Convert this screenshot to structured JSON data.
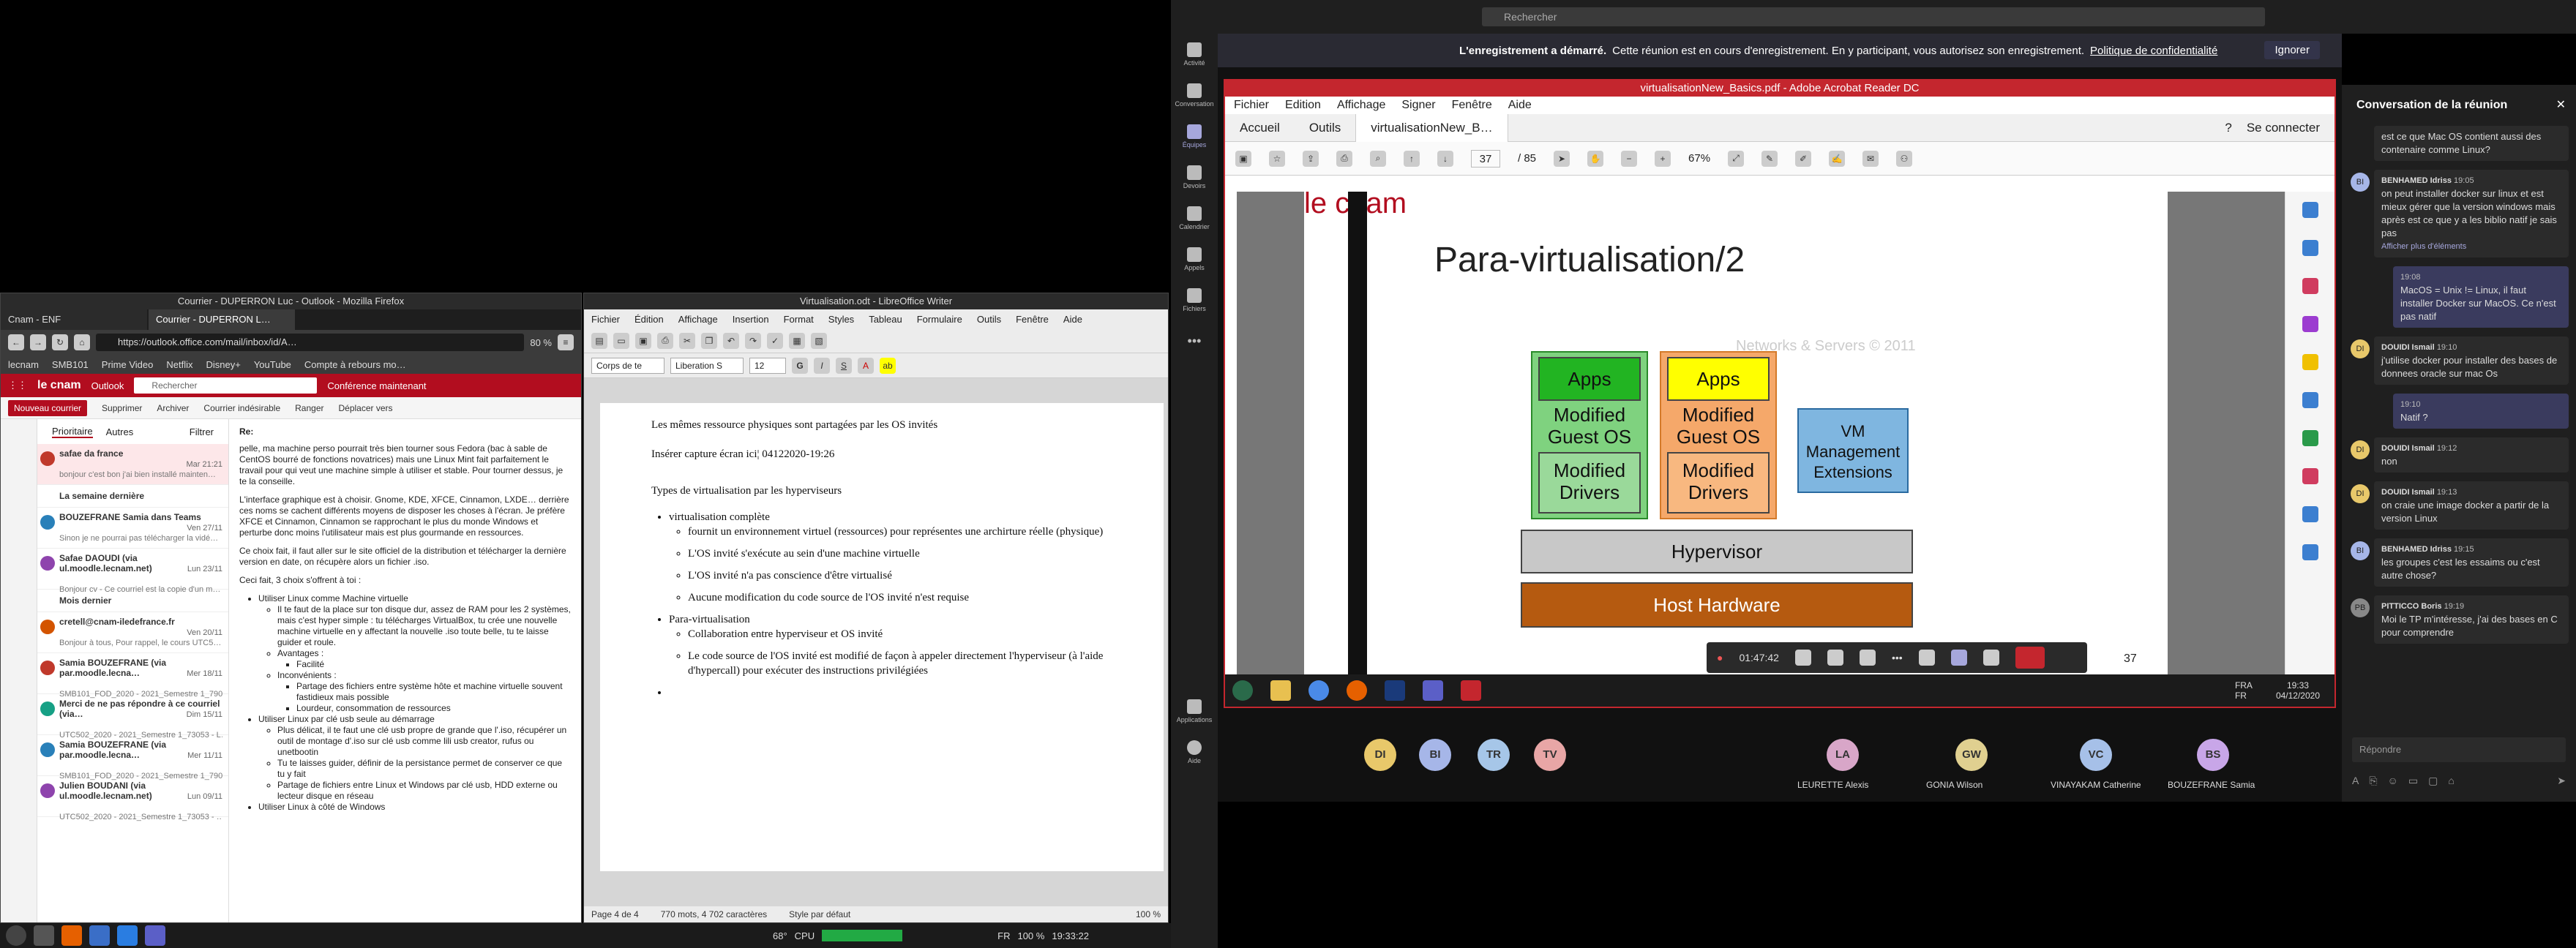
{
  "firefox": {
    "title": "Courrier - DUPERRON Luc - Outlook - Mozilla Firefox",
    "tabs": [
      "Cnam - ENF",
      "Courrier - DUPERRON L…"
    ],
    "url": "https://outlook.office.com/mail/inbox/id/A…",
    "zoom": "80 %",
    "bookmarks": [
      "lecnam",
      "SMB101",
      "Prime Video",
      "Netflix",
      "Disney+",
      "YouTube",
      "Compte à rebours mo…"
    ]
  },
  "outlook": {
    "brand": "Outlook",
    "search_placeholder": "Rechercher",
    "conf_link": "Conférence maintenant",
    "commands": [
      "Nouveau courrier",
      "Supprimer",
      "Archiver",
      "Courrier indésirable",
      "Ranger",
      "Déplacer vers"
    ],
    "list_tabs": [
      "Prioritaire",
      "Autres",
      "Filtrer"
    ],
    "reply_label": "Re:",
    "mails": [
      {
        "from": "safae da france",
        "prev": "bonjour c'est bon j'ai bien installé mainten…",
        "date": "Mar 21:21",
        "sel": true
      },
      {
        "section": "La semaine dernière"
      },
      {
        "from": "BOUZEFRANE Samia dans Teams",
        "prev": "Sinon je ne pourrai pas télécharger la vidé…",
        "date": "Ven 27/11"
      },
      {
        "from": "Safae DAOUDI (via ul.moodle.lecnam.net)",
        "prev": "Bonjour cv - Ce courriel est la copie d'un m…",
        "date": "Lun 23/11"
      },
      {
        "section": "Mois dernier"
      },
      {
        "from": "cretell@cnam-iledefrance.fr",
        "prev": "Bonjour à tous, Pour rappel, le cours UTC5…",
        "date": "Ven 20/11"
      },
      {
        "from": "Samia BOUZEFRANE (via par.moodle.lecna…",
        "prev": "SMB101_FOD_2020 - 2021_Semestre 1_7905…",
        "date": "Mer 18/11"
      },
      {
        "from": "Merci de ne pas répondre à ce courriel (via…",
        "prev": "UTC502_2020 - 2021_Semestre 1_73053 - L…",
        "date": "Dim 15/11"
      },
      {
        "from": "Samia BOUZEFRANE (via par.moodle.lecna…",
        "prev": "SMB101_FOD_2020 - 2021_Semestre 1_790…",
        "date": "Mer 11/11"
      },
      {
        "from": "Julien BOUDANI (via ul.moodle.lecnam.net)",
        "prev": "UTC502_2020 - 2021_Semestre 1_73053 - …",
        "date": "Lun 09/11"
      }
    ],
    "reading": {
      "p1": "pelle, ma machine perso pourrait très bien tourner sous Fedora (bac à sable de CentOS bourré de fonctions novatrices) mais une Linux Mint fait parfaitement le travail pour qui veut une machine simple à utiliser et stable. Pour tourner dessus, je te la conseille.",
      "p2": "L'interface graphique est à choisir. Gnome, KDE, XFCE, Cinnamon, LXDE… derrière ces noms se cachent différents moyens de disposer les choses à l'écran. Je préfère XFCE et Cinnamon, Cinnamon se rapprochant le plus du monde Windows et perturbe donc moins l'utilisateur mais est plus gourmande en ressources.",
      "p3": "Ce choix fait, il faut aller sur le site officiel de la distribution et télécharger la dernière version en date, on récupère alors un fichier .iso.",
      "p4": "Ceci fait, 3 choix s'offrent à toi :",
      "b1": "Utiliser Linux comme Machine virtuelle",
      "b1a": "Il te faut de la place sur ton disque dur, assez de RAM pour les 2 systèmes, mais c'est hyper simple : tu télécharges VirtualBox, tu crée une nouvelle machine virtuelle en y affectant la nouvelle .iso toute belle, tu te laisse guider et roule.",
      "b1b": "Avantages :",
      "b1b1": "Facilité",
      "b1c": "Inconvénients :",
      "b1c1": "Partage des fichiers entre système hôte et machine virtuelle souvent fastidieux mais possible",
      "b1c2": "Lourdeur, consommation de ressources",
      "b2": "Utiliser Linux par clé usb seule au démarrage",
      "b2a": "Plus délicat, il te faut une clé usb propre de grande que l'.iso, récupérer un outil de montage d'.iso sur clé usb comme lili usb creator, rufus ou unetbootin",
      "b2b": "Tu te laisses guider, définir de la persistance permet de conserver ce que tu y fait",
      "b2c": "Partage de fichiers entre Linux et Windows par clé usb, HDD externe ou lecteur disque en réseau",
      "b3": "Utiliser Linux à côté de Windows"
    }
  },
  "writer": {
    "title": "Virtualisation.odt - LibreOffice Writer",
    "menu": [
      "Fichier",
      "Édition",
      "Affichage",
      "Insertion",
      "Format",
      "Styles",
      "Tableau",
      "Formulaire",
      "Outils",
      "Fenêtre",
      "Aide"
    ],
    "style": "Corps de te",
    "font": "Liberation S",
    "size": "12",
    "doc": {
      "l1": "Les mêmes ressource physiques sont partagées par les OS invités",
      "l2": "Insérer capture écran ici¦ 04122020-19:26",
      "l3": "Types de virtualisation par les hyperviseurs",
      "b1": "virtualisation complète",
      "b1a": "fournit un environnement virtuel (ressources) pour représentes une archirture réelle (physique)",
      "b1b": "L'OS invité s'exécute au sein d'une machine virtuelle",
      "b1c": "L'OS invité n'a pas conscience d'être virtualisé",
      "b1d": "Aucune modification du code source de l'OS invité n'est requise",
      "b2": "Para-virtualisation",
      "b2a": "Collaboration entre hyperviseur et OS invité",
      "b2b": "Le code source de l'OS invité est modifié de façon à appeler directement l'hyperviseur (à l'aide d'hypercall) pour exécuter des instructions privilégiées"
    },
    "status": [
      "Page 4 de 4",
      "770 mots, 4 702 caractères",
      "Style par défaut",
      "100 %"
    ]
  },
  "taskbar": {
    "temp": "68°",
    "cpu": "CPU",
    "lang": "FR",
    "battery": "100 %",
    "time": "19:33:22"
  },
  "teams": {
    "search": "Rechercher",
    "rail": [
      "Activité",
      "Conversation",
      "Équipes",
      "Devoirs",
      "Calendrier",
      "Appels",
      "Fichiers",
      "Applications",
      "Aide"
    ],
    "banner_bold": "L'enregistrement a démarré.",
    "banner_text": "Cette réunion est en cours d'enregistrement. En y participant, vous autorisez son enregistrement.",
    "banner_link": "Politique de confidentialité",
    "banner_ignore": "Ignorer",
    "timer": "01:47:42",
    "participants": [
      {
        "init": "DI",
        "color": "#e8c86a"
      },
      {
        "init": "BI",
        "color": "#a6b6e8"
      },
      {
        "init": "TR",
        "color": "#a6c6e8"
      },
      {
        "init": "TV",
        "color": "#e8a6a6"
      },
      {
        "init": "LA",
        "color": "#d8a6c8",
        "name": "LEURETTE Alexis"
      },
      {
        "init": "GW",
        "color": "#e0d090",
        "name": "GONIA Wilson"
      },
      {
        "init": "VC",
        "color": "#a6c0e8",
        "name": "VINAYAKAM Catherine"
      },
      {
        "init": "BS",
        "color": "#c8a6e8",
        "name": "BOUZEFRANE Samia"
      }
    ]
  },
  "acrobat": {
    "title": "virtualisationNew_Basics.pdf - Adobe Acrobat Reader DC",
    "menu": [
      "Fichier",
      "Edition",
      "Affichage",
      "Signer",
      "Fenêtre",
      "Aide"
    ],
    "tabs": [
      "Accueil",
      "Outils",
      "virtualisationNew_B…"
    ],
    "login": "Se connecter",
    "page": "37",
    "pages": "/ 85",
    "zoom": "67%",
    "slide": {
      "logo": "le cnam",
      "title": "Para-virtualisation/2",
      "watermark": "Networks & Servers © 2011",
      "apps": "Apps",
      "guest": "Modified Guest OS",
      "drivers": "Modified Drivers",
      "vm": "VM Management Extensions",
      "hyp": "Hypervisor",
      "hw": "Host Hardware",
      "num": "37"
    },
    "task_lang": "FRA\nFR",
    "task_time": "19:33",
    "task_date": "04/12/2020"
  },
  "chat": {
    "title": "Conversation de la réunion",
    "reply": "Répondre",
    "messages": [
      {
        "who": "",
        "time": "",
        "text": "est ce que Mac OS contient aussi des contenaire comme Linux?",
        "me": false,
        "av": "",
        "color": "#1f1f1f"
      },
      {
        "who": "BENHAMED Idriss",
        "time": "19:05",
        "text": "on peut installer docker sur linux et est mieux gérer que la version windows mais après est ce que y a les biblio natif je sais pas",
        "me": false,
        "av": "BI",
        "color": "#a6b6e8",
        "extra": "Afficher plus d'éléments"
      },
      {
        "who": "",
        "time": "19:08",
        "text": "MacOS = Unix != Linux, il faut installer Docker sur MacOS. Ce n'est pas natif",
        "me": true
      },
      {
        "who": "DOUIDI Ismail",
        "time": "19:10",
        "text": "j'utilise docker pour installer des bases de donnees oracle sur mac Os",
        "me": false,
        "av": "DI",
        "color": "#e8c86a"
      },
      {
        "who": "",
        "time": "19:10",
        "text": "Natif ?",
        "me": true
      },
      {
        "who": "DOUIDI Ismail",
        "time": "19:12",
        "text": "non",
        "me": false,
        "av": "DI",
        "color": "#e8c86a"
      },
      {
        "who": "DOUIDI Ismail",
        "time": "19:13",
        "text": "on craie une image docker a partir de la version Linux",
        "me": false,
        "av": "DI",
        "color": "#e8c86a"
      },
      {
        "who": "BENHAMED Idriss",
        "time": "19:15",
        "text": "les groupes c'est les essaims ou c'est autre chose?",
        "me": false,
        "av": "BI",
        "color": "#a6b6e8"
      },
      {
        "who": "PITTICCO Boris",
        "time": "19:19",
        "text": "Moi le TP m'intéresse, j'ai des bases en C pour comprendre",
        "me": false,
        "av": "PB",
        "color": "#888"
      }
    ]
  }
}
